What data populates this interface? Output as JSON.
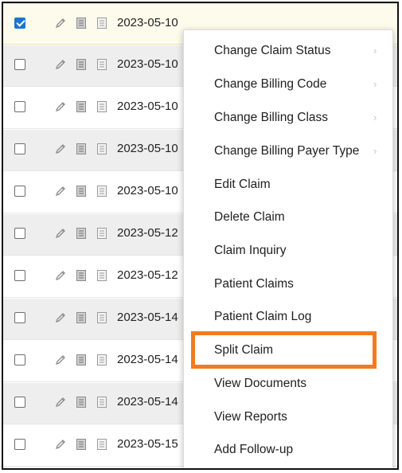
{
  "rows": [
    {
      "date": "2023-05-10",
      "checked": true,
      "edge": ""
    },
    {
      "date": "2023-05-10",
      "checked": false,
      "edge": ""
    },
    {
      "date": "2023-05-10",
      "checked": false,
      "edge": ""
    },
    {
      "date": "2023-05-10",
      "checked": false,
      "edge": "d"
    },
    {
      "date": "2023-05-10",
      "checked": false,
      "edge": "r"
    },
    {
      "date": "2023-05-12",
      "checked": false,
      "edge": "b"
    },
    {
      "date": "2023-05-12",
      "checked": false,
      "edge": ""
    },
    {
      "date": "2023-05-14",
      "checked": false,
      "edge": ""
    },
    {
      "date": "2023-05-14",
      "checked": false,
      "edge": ""
    },
    {
      "date": "2023-05-14",
      "checked": false,
      "edge": ""
    },
    {
      "date": "2023-05-15",
      "checked": false,
      "edge": "d"
    }
  ],
  "context_menu": {
    "items": [
      {
        "label": "Change Claim Status",
        "submenu": true
      },
      {
        "label": "Change Billing Code",
        "submenu": true
      },
      {
        "label": "Change Billing Class",
        "submenu": true
      },
      {
        "label": "Change Billing Payer Type",
        "submenu": true
      },
      {
        "label": "Edit Claim",
        "submenu": false
      },
      {
        "label": "Delete Claim",
        "submenu": false
      },
      {
        "label": "Claim Inquiry",
        "submenu": false
      },
      {
        "label": "Patient Claims",
        "submenu": false
      },
      {
        "label": "Patient Claim Log",
        "submenu": false
      },
      {
        "label": "Split Claim",
        "submenu": false,
        "highlighted": true
      },
      {
        "label": "View Documents",
        "submenu": false
      },
      {
        "label": "View Reports",
        "submenu": false
      },
      {
        "label": "Add Follow-up",
        "submenu": false
      }
    ],
    "submenu_arrow": "›"
  },
  "colors": {
    "highlight_box": "#f27b21",
    "checkbox_checked": "#1976d2",
    "row_alt": "#eeeeee",
    "row_selected": "#fdfcec"
  },
  "icons": [
    "pencil-icon",
    "document-icon",
    "notes-icon"
  ]
}
